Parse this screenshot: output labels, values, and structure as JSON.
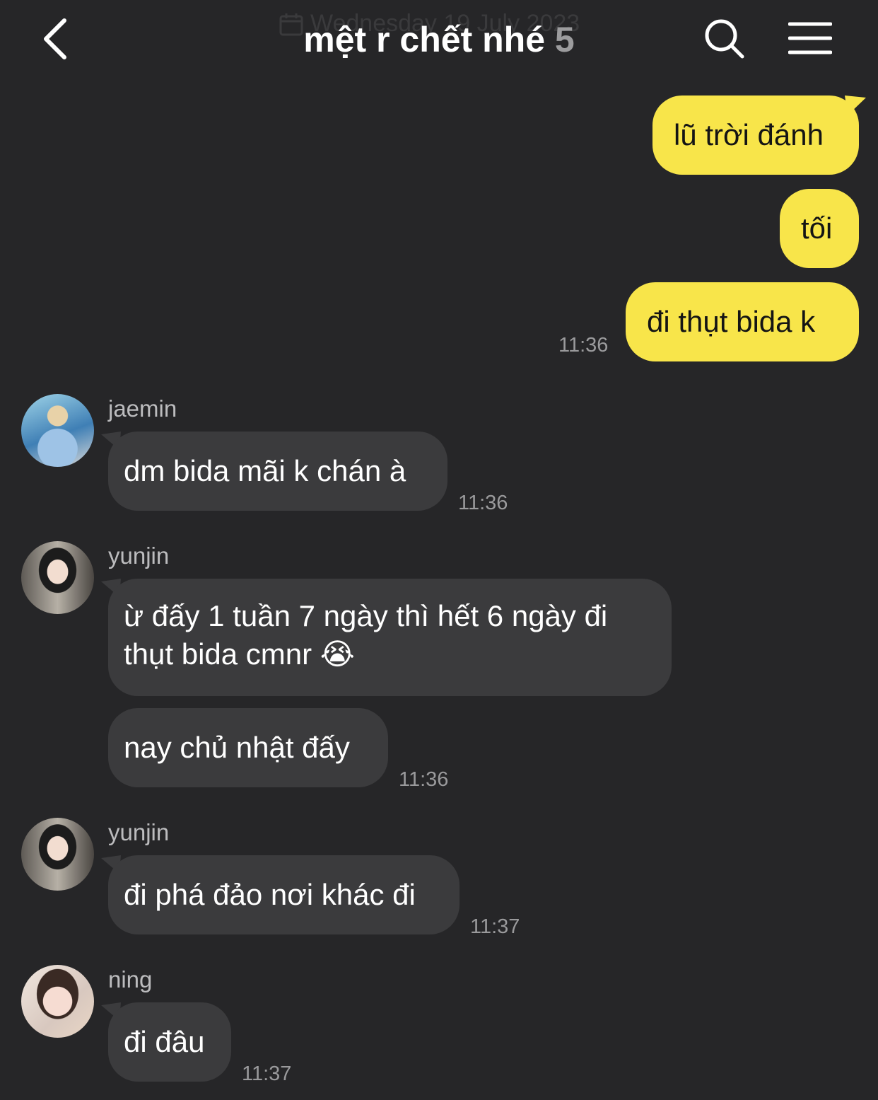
{
  "header": {
    "date_ghost": "Wednesday 19 July 2023",
    "title": "mệt r chết nhé",
    "member_count": "5",
    "back_icon": "chevron-left-icon",
    "search_icon": "search-icon",
    "menu_icon": "hamburger-menu-icon"
  },
  "colors": {
    "background": "#262628",
    "my_bubble": "#f8e54a",
    "their_bubble": "#3b3b3d"
  },
  "messages": {
    "m1": {
      "text": "lũ trời đánh"
    },
    "m2": {
      "text": "tối"
    },
    "m3": {
      "text": "đi thụt bida k",
      "time": "11:36"
    },
    "g1": {
      "sender": "jaemin",
      "text": "dm bida mãi k chán à",
      "time": "11:36"
    },
    "g2": {
      "sender": "yunjin",
      "text": "ừ đấy 1 tuần 7 ngày thì hết 6 ngày đi thụt bida cmnr 😭"
    },
    "g3": {
      "text": "nay chủ nhật đấy",
      "time": "11:36"
    },
    "g4": {
      "sender": "yunjin",
      "text": "đi phá đảo nơi khác đi",
      "time": "11:37"
    },
    "g5": {
      "sender": "ning",
      "text": "đi đâu",
      "time": "11:37"
    }
  }
}
